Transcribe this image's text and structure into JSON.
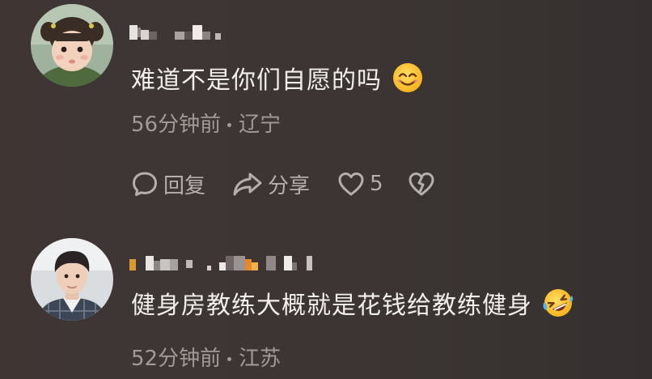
{
  "colors": {
    "background": "#3c3533",
    "primary_text": "#f1eeec",
    "secondary_text": "#a29a97",
    "action_icon": "#b5aeab"
  },
  "comments": [
    {
      "avatar": "avatar-child-with-pigtails",
      "username_redacted": true,
      "text": "难道不是你们自愿的吗",
      "emoji": "smiling-face-emoji",
      "time": "56分钟前",
      "location": "辽宁",
      "actions": {
        "reply_label": "回复",
        "share_label": "分享",
        "like_count": "5",
        "reply_icon": "speech-bubble-icon",
        "share_icon": "share-arrow-icon",
        "like_icon": "heart-outline-icon",
        "dislike_icon": "broken-heart-icon"
      }
    },
    {
      "avatar": "avatar-young-man",
      "username_redacted": true,
      "text": "健身房教练大概就是花钱给教练健身",
      "emoji": "rolling-laughing-emoji",
      "time": "52分钟前",
      "location": "江苏"
    }
  ]
}
